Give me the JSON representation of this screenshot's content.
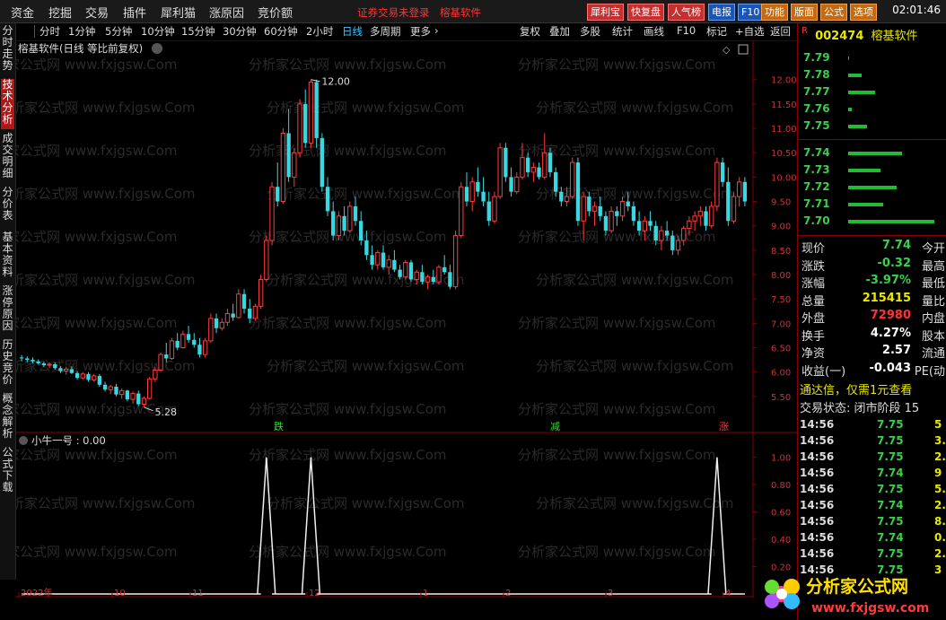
{
  "menu": {
    "items": [
      "资金",
      "挖掘",
      "交易",
      "插件",
      "犀利猫",
      "涨原因",
      "竞价额"
    ],
    "notice": "证券交易未登录",
    "notice2": "榕基软件",
    "buttons": [
      "犀利宝",
      "快复盘",
      "人气榜",
      "电报",
      "F10",
      "功能",
      "版面",
      "公式",
      "选项"
    ],
    "clock": "02:01:46"
  },
  "period_bar": {
    "periods": [
      "分时",
      "1分钟",
      "5分钟",
      "10分钟",
      "15分钟",
      "30分钟",
      "60分钟",
      "2小时",
      "日线",
      "多周期",
      "更多"
    ],
    "active": "日线",
    "tools": [
      "复权",
      "叠加",
      "多股",
      "统计",
      "画线",
      "F10",
      "标记",
      "+自选",
      "返回"
    ]
  },
  "left_tabs": [
    "分时走势",
    "技术分析",
    "成交明细",
    "分价表",
    "基本资料",
    "涨停原因",
    "历史竞价",
    "概念解析",
    "公式下载"
  ],
  "left_tab_active": "技术分析",
  "main_chart": {
    "title": "榕基软件(日线 等比前复权)",
    "high_label": "12.00",
    "low_label": "5.28",
    "markers": [
      {
        "text": "跌",
        "color": "#33dd33"
      },
      {
        "text": "减",
        "color": "#33dd33"
      },
      {
        "text": "涨",
        "color": "#ff3333"
      }
    ],
    "watermark": "分析家公式网 www.fxjgsw.Com"
  },
  "sub_chart": {
    "title": "小牛一号 : 0.00",
    "y_ticks": [
      "1.00",
      "0.80",
      "0.60",
      "0.40",
      "0.20"
    ]
  },
  "x_axis": [
    "2022年",
    "10",
    "11",
    "12",
    "1",
    "2",
    "3",
    "4"
  ],
  "chart_data": [
    {
      "type": "candlestick",
      "title": "榕基软件(日线 等比前复权)",
      "ylim": [
        5.0,
        12.4
      ],
      "y_ticks": [
        "12.00",
        "11.50",
        "11.00",
        "10.50",
        "10.00",
        "9.50",
        "9.00",
        "8.50",
        "8.00",
        "7.50",
        "7.00",
        "6.50",
        "6.00",
        "5.50"
      ],
      "annotations": [
        {
          "text": "12.00",
          "type": "high"
        },
        {
          "text": "5.28",
          "type": "low"
        }
      ],
      "ohlc": [
        [
          6.3,
          6.35,
          6.22,
          6.28
        ],
        [
          6.28,
          6.32,
          6.2,
          6.25
        ],
        [
          6.25,
          6.3,
          6.18,
          6.22
        ],
        [
          6.22,
          6.26,
          6.15,
          6.18
        ],
        [
          6.18,
          6.22,
          6.1,
          6.14
        ],
        [
          6.14,
          6.2,
          6.08,
          6.16
        ],
        [
          6.16,
          6.2,
          6.05,
          6.08
        ],
        [
          6.08,
          6.12,
          5.98,
          6.02
        ],
        [
          6.02,
          6.1,
          5.95,
          6.06
        ],
        [
          6.06,
          6.12,
          5.96,
          5.98
        ],
        [
          5.98,
          6.02,
          5.85,
          5.88
        ],
        [
          5.88,
          6.0,
          5.84,
          5.96
        ],
        [
          5.96,
          6.0,
          5.8,
          5.84
        ],
        [
          5.84,
          5.96,
          5.8,
          5.92
        ],
        [
          5.92,
          5.96,
          5.7,
          5.74
        ],
        [
          5.74,
          5.8,
          5.6,
          5.64
        ],
        [
          5.64,
          5.74,
          5.55,
          5.7
        ],
        [
          5.7,
          5.76,
          5.5,
          5.54
        ],
        [
          5.54,
          5.66,
          5.45,
          5.62
        ],
        [
          5.62,
          5.64,
          5.4,
          5.44
        ],
        [
          5.44,
          5.6,
          5.35,
          5.56
        ],
        [
          5.56,
          5.62,
          5.3,
          5.34
        ],
        [
          5.34,
          5.5,
          5.28,
          5.46
        ],
        [
          5.46,
          5.9,
          5.44,
          5.86
        ],
        [
          5.86,
          6.1,
          5.8,
          6.04
        ],
        [
          6.04,
          6.4,
          6.0,
          6.36
        ],
        [
          6.36,
          6.6,
          6.2,
          6.28
        ],
        [
          6.28,
          6.7,
          6.25,
          6.64
        ],
        [
          6.64,
          6.8,
          6.45,
          6.5
        ],
        [
          6.5,
          6.85,
          6.48,
          6.78
        ],
        [
          6.78,
          6.95,
          6.6,
          6.66
        ],
        [
          6.66,
          6.8,
          6.5,
          6.56
        ],
        [
          6.56,
          6.7,
          6.3,
          6.36
        ],
        [
          6.36,
          6.7,
          6.3,
          6.64
        ],
        [
          6.64,
          7.2,
          6.6,
          7.1
        ],
        [
          7.1,
          7.2,
          6.8,
          6.9
        ],
        [
          6.9,
          7.1,
          6.85,
          7.02
        ],
        [
          7.02,
          7.3,
          6.95,
          7.2
        ],
        [
          7.2,
          7.4,
          7.05,
          7.12
        ],
        [
          7.12,
          7.7,
          7.1,
          7.6
        ],
        [
          7.6,
          7.7,
          7.2,
          7.3
        ],
        [
          7.3,
          7.5,
          7.0,
          7.1
        ],
        [
          7.1,
          7.4,
          7.05,
          7.35
        ],
        [
          7.35,
          8.0,
          7.3,
          7.9
        ],
        [
          7.9,
          8.8,
          7.85,
          8.7
        ],
        [
          8.7,
          9.9,
          8.6,
          9.8
        ],
        [
          9.8,
          10.3,
          9.4,
          9.5
        ],
        [
          9.5,
          11.0,
          9.45,
          10.9
        ],
        [
          10.9,
          11.4,
          9.9,
          10.0
        ],
        [
          10.0,
          10.6,
          9.8,
          10.5
        ],
        [
          10.5,
          11.6,
          10.4,
          11.5
        ],
        [
          11.5,
          11.8,
          10.6,
          10.7
        ],
        [
          10.7,
          12.0,
          10.6,
          11.95
        ],
        [
          11.95,
          12.0,
          10.6,
          10.8
        ],
        [
          10.8,
          10.9,
          9.7,
          9.8
        ],
        [
          9.8,
          10.0,
          9.2,
          9.3
        ],
        [
          9.3,
          9.5,
          8.7,
          8.8
        ],
        [
          8.8,
          9.3,
          8.7,
          9.2
        ],
        [
          9.2,
          9.4,
          8.8,
          8.9
        ],
        [
          8.9,
          9.5,
          8.85,
          9.4
        ],
        [
          9.4,
          9.6,
          9.0,
          9.1
        ],
        [
          9.1,
          9.3,
          8.6,
          8.7
        ],
        [
          8.7,
          8.9,
          8.3,
          8.4
        ],
        [
          8.4,
          8.6,
          8.1,
          8.2
        ],
        [
          8.2,
          8.5,
          8.1,
          8.45
        ],
        [
          8.45,
          8.6,
          8.1,
          8.15
        ],
        [
          8.15,
          8.4,
          8.0,
          8.3
        ],
        [
          8.3,
          8.5,
          8.05,
          8.1
        ],
        [
          8.1,
          8.2,
          7.9,
          7.95
        ],
        [
          7.95,
          8.3,
          7.9,
          8.25
        ],
        [
          8.25,
          8.3,
          7.85,
          7.9
        ],
        [
          7.9,
          8.1,
          7.8,
          8.05
        ],
        [
          8.05,
          8.2,
          7.8,
          7.85
        ],
        [
          7.85,
          8.0,
          7.7,
          7.95
        ],
        [
          7.95,
          8.1,
          7.8,
          7.85
        ],
        [
          7.85,
          8.2,
          7.8,
          8.15
        ],
        [
          8.15,
          8.4,
          8.0,
          8.05
        ],
        [
          8.05,
          8.2,
          7.7,
          7.75
        ],
        [
          7.75,
          8.9,
          7.7,
          8.8
        ],
        [
          8.8,
          9.9,
          8.75,
          9.8
        ],
        [
          9.8,
          10.1,
          9.4,
          9.5
        ],
        [
          9.5,
          10.0,
          9.3,
          9.9
        ],
        [
          9.9,
          10.2,
          9.6,
          9.7
        ],
        [
          9.7,
          10.0,
          9.4,
          9.5
        ],
        [
          9.5,
          9.7,
          9.0,
          9.1
        ],
        [
          9.1,
          9.7,
          9.05,
          9.6
        ],
        [
          9.6,
          10.7,
          9.55,
          10.6
        ],
        [
          10.6,
          10.7,
          9.9,
          10.0
        ],
        [
          10.0,
          10.2,
          9.6,
          9.7
        ],
        [
          9.7,
          10.1,
          9.65,
          10.0
        ],
        [
          10.0,
          10.7,
          9.95,
          10.4
        ],
        [
          10.4,
          10.5,
          10.0,
          10.1
        ],
        [
          10.1,
          10.3,
          9.9,
          10.2
        ],
        [
          10.2,
          10.3,
          9.95,
          10.0
        ],
        [
          10.0,
          10.9,
          9.95,
          10.5
        ],
        [
          10.5,
          10.6,
          10.0,
          10.1
        ],
        [
          10.1,
          10.2,
          9.6,
          9.7
        ],
        [
          9.7,
          9.8,
          9.4,
          9.5
        ],
        [
          9.5,
          9.8,
          9.4,
          9.6
        ],
        [
          9.6,
          10.4,
          9.55,
          10.3
        ],
        [
          10.3,
          10.4,
          9.0,
          9.1
        ],
        [
          9.1,
          9.7,
          8.7,
          9.6
        ],
        [
          9.6,
          9.7,
          9.2,
          9.3
        ],
        [
          9.3,
          9.5,
          9.0,
          9.4
        ],
        [
          9.4,
          9.6,
          9.1,
          9.2
        ],
        [
          9.2,
          9.3,
          8.8,
          8.9
        ],
        [
          8.9,
          9.4,
          8.85,
          9.3
        ],
        [
          9.3,
          9.4,
          9.0,
          9.2
        ],
        [
          9.2,
          9.6,
          9.1,
          9.5
        ],
        [
          9.5,
          9.7,
          9.3,
          9.4
        ],
        [
          9.4,
          9.5,
          9.0,
          9.1
        ],
        [
          9.1,
          9.3,
          8.8,
          8.9
        ],
        [
          8.9,
          9.2,
          8.7,
          9.1
        ],
        [
          9.1,
          9.3,
          8.9,
          9.0
        ],
        [
          9.0,
          9.1,
          8.6,
          8.7
        ],
        [
          8.7,
          9.0,
          8.5,
          8.9
        ],
        [
          8.9,
          9.1,
          8.7,
          8.8
        ],
        [
          8.8,
          8.9,
          8.4,
          8.5
        ],
        [
          8.5,
          8.8,
          8.4,
          8.7
        ],
        [
          8.7,
          9.0,
          8.6,
          8.95
        ],
        [
          8.95,
          9.2,
          8.8,
          9.1
        ],
        [
          9.1,
          9.3,
          8.9,
          9.2
        ],
        [
          9.2,
          9.4,
          9.0,
          9.3
        ],
        [
          9.3,
          9.4,
          8.9,
          9.0
        ],
        [
          9.0,
          9.5,
          8.95,
          9.4
        ],
        [
          9.4,
          10.4,
          9.3,
          10.3
        ],
        [
          10.3,
          10.4,
          9.8,
          9.9
        ],
        [
          9.9,
          10.2,
          9.0,
          9.1
        ],
        [
          9.1,
          9.7,
          9.05,
          9.6
        ],
        [
          9.6,
          10.0,
          9.4,
          9.9
        ],
        [
          9.9,
          10.0,
          9.4,
          9.5
        ]
      ]
    },
    {
      "type": "line",
      "title": "小牛一号 : 0.00",
      "ylim": [
        0,
        1.05
      ],
      "y_ticks": [
        "1.00",
        "0.80",
        "0.60",
        "0.40",
        "0.20"
      ],
      "spikes": [
        {
          "index": 44,
          "value": 1.0
        },
        {
          "index": 52,
          "value": 1.0
        },
        {
          "index": 125,
          "value": 1.0
        }
      ]
    }
  ],
  "quote": {
    "code": "002474",
    "name": "榕基软件",
    "orderbook_sell": [
      {
        "price": "7.79",
        "bar": 0.02
      },
      {
        "price": "7.78",
        "bar": 0.25
      },
      {
        "price": "7.77",
        "bar": 0.5
      },
      {
        "price": "7.76",
        "bar": 0.07
      },
      {
        "price": "7.75",
        "bar": 0.35
      }
    ],
    "orderbook_buy": [
      {
        "price": "7.74",
        "bar": 1.0
      },
      {
        "price": "7.73",
        "bar": 0.6
      },
      {
        "price": "7.72",
        "bar": 0.9
      },
      {
        "price": "7.71",
        "bar": 0.65
      },
      {
        "price": "7.70",
        "bar": 1.6
      }
    ],
    "rows": [
      {
        "label": "现价",
        "value": "7.74",
        "color": "#39d04a",
        "label2": "今开"
      },
      {
        "label": "涨跌",
        "value": "-0.32",
        "color": "#39d04a",
        "label2": "最高"
      },
      {
        "label": "涨幅",
        "value": "-3.97%",
        "color": "#39d04a",
        "label2": "最低"
      },
      {
        "label": "总量",
        "value": "215415",
        "color": "#e8e800",
        "label2": "量比"
      },
      {
        "label": "外盘",
        "value": "72980",
        "color": "#ff3333",
        "label2": "内盘"
      },
      {
        "label": "换手",
        "value": "4.27%",
        "color": "#ffffff",
        "label2": "股本"
      },
      {
        "label": "净资",
        "value": "2.57",
        "color": "#ffffff",
        "label2": "流通"
      },
      {
        "label": "收益(一)",
        "value": "-0.043",
        "color": "#ffffff",
        "label2": "PE(动"
      }
    ],
    "promo": "通达信，仅需1元查看",
    "trade_status": "交易状态: 闭市阶段 15",
    "ticks": [
      {
        "time": "14:56",
        "price": "7.75",
        "vol": "5"
      },
      {
        "time": "14:56",
        "price": "7.75",
        "vol": "3."
      },
      {
        "time": "14:56",
        "price": "7.75",
        "vol": "2."
      },
      {
        "time": "14:56",
        "price": "7.74",
        "vol": "9"
      },
      {
        "time": "14:56",
        "price": "7.75",
        "vol": "5."
      },
      {
        "time": "14:56",
        "price": "7.74",
        "vol": "2."
      },
      {
        "time": "14:56",
        "price": "7.75",
        "vol": "8."
      },
      {
        "time": "14:56",
        "price": "7.74",
        "vol": "0."
      },
      {
        "time": "14:56",
        "price": "7.75",
        "vol": "2."
      },
      {
        "time": "14:56",
        "price": "7.75",
        "vol": "3"
      }
    ]
  },
  "logo": {
    "title": "分析家公式网",
    "url": "www.fxjgsw.com"
  }
}
